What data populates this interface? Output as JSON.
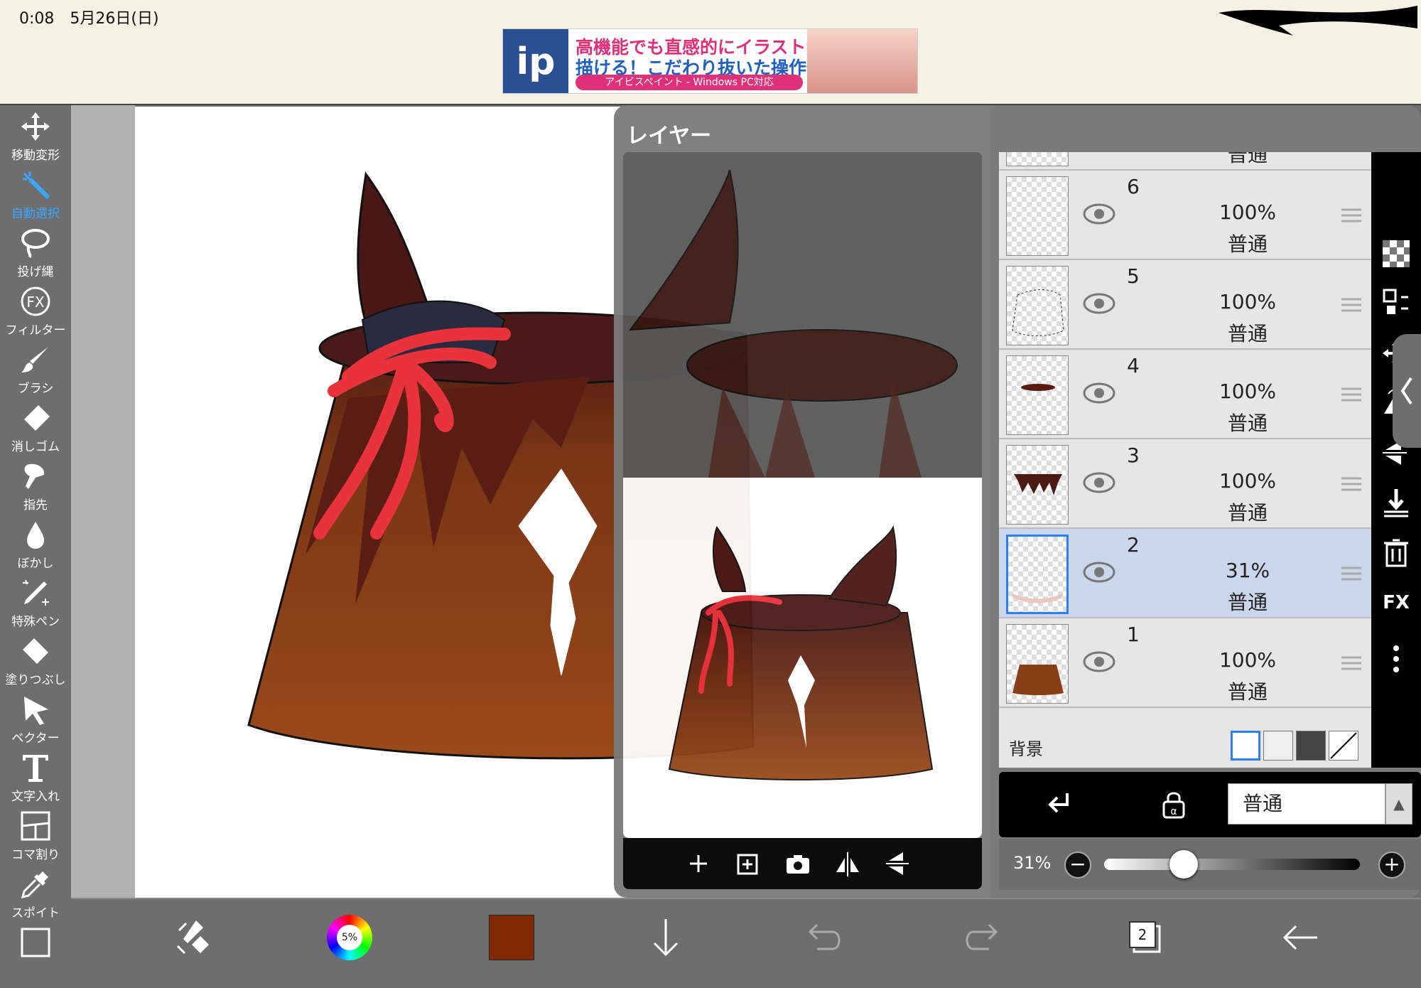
{
  "status": {
    "time_date": "0:08　5月26日(日)"
  },
  "ad": {
    "logo": "ip",
    "line1": "高機能でも直感的にイラストが",
    "line2": "描ける！こだわり抜いた操作性！",
    "line3": "アイビスペイント - Windows PC対応"
  },
  "tools": [
    {
      "label": "移動変形",
      "icon": "move-icon"
    },
    {
      "label": "自動選択",
      "icon": "magic-wand-icon",
      "active": true
    },
    {
      "label": "投げ縄",
      "icon": "lasso-icon"
    },
    {
      "label": "フィルター",
      "icon": "fx-icon"
    },
    {
      "label": "ブラシ",
      "icon": "brush-icon"
    },
    {
      "label": "消しゴム",
      "icon": "eraser-icon"
    },
    {
      "label": "指先",
      "icon": "finger-icon"
    },
    {
      "label": "ぼかし",
      "icon": "blur-drop-icon"
    },
    {
      "label": "特殊ペン",
      "icon": "special-pen-icon"
    },
    {
      "label": "塗りつぶし",
      "icon": "fill-bucket-icon"
    },
    {
      "label": "ベクター",
      "icon": "vector-cursor-icon"
    },
    {
      "label": "文字入れ",
      "icon": "text-icon"
    },
    {
      "label": "コマ割り",
      "icon": "frame-divider-icon"
    },
    {
      "label": "スポイト",
      "icon": "eyedropper-icon"
    }
  ],
  "layer_panel": {
    "title": "レイヤー",
    "top_partial_mode": "普通",
    "layers": [
      {
        "num": "6",
        "opacity": "100%",
        "mode": "普通"
      },
      {
        "num": "5",
        "opacity": "100%",
        "mode": "普通"
      },
      {
        "num": "4",
        "opacity": "100%",
        "mode": "普通"
      },
      {
        "num": "3",
        "opacity": "100%",
        "mode": "普通"
      },
      {
        "num": "2",
        "opacity": "31%",
        "mode": "普通",
        "selected": true
      },
      {
        "num": "1",
        "opacity": "100%",
        "mode": "普通"
      }
    ],
    "background_label": "背景",
    "blend_mode": "普通",
    "opacity_label": "31%",
    "opacity_value": 0.31,
    "fx_label": "FX"
  },
  "bottom": {
    "brush_size": "5%",
    "layer_count": "2",
    "color": "#7f2a00"
  },
  "colors": {
    "accent": "#3aa6ff",
    "selected_row": "#c9d6ec",
    "hat_brown": "#8a3e16",
    "ribbon_red": "#e8323c"
  }
}
